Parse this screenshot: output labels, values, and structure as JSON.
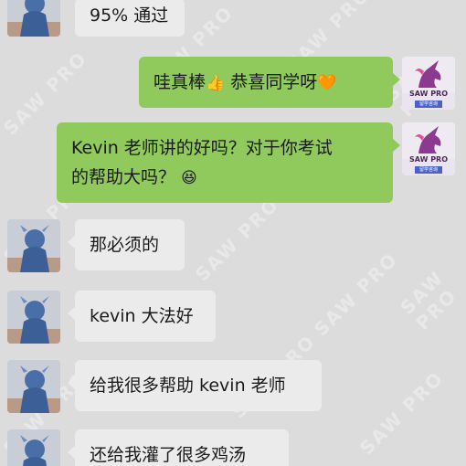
{
  "messages": [
    {
      "side": "in",
      "text": "95% 通过"
    },
    {
      "side": "out",
      "text": "哇真棒",
      "emoji1": "👍",
      "text2": " 恭喜同学呀",
      "emoji2": "🧡"
    },
    {
      "side": "out",
      "line1": "Kevin 老师讲的好吗？对于你考试",
      "line2": "的帮助大吗？",
      "emoji": "😆"
    },
    {
      "side": "in",
      "text": "那必须的"
    },
    {
      "side": "in",
      "text": "kevin 大法好"
    },
    {
      "side": "in",
      "text": "给我很多帮助 kevin 老师"
    },
    {
      "side": "in",
      "text": "还给我灌了很多鸡汤"
    }
  ],
  "watermark": "SAW PRO",
  "logo": {
    "brand": "SAW PRO",
    "strip": "留学咨询"
  },
  "colors": {
    "bg": "#dcdcdc",
    "bubble_in": "#ebebeb",
    "bubble_out": "#90c95c"
  }
}
